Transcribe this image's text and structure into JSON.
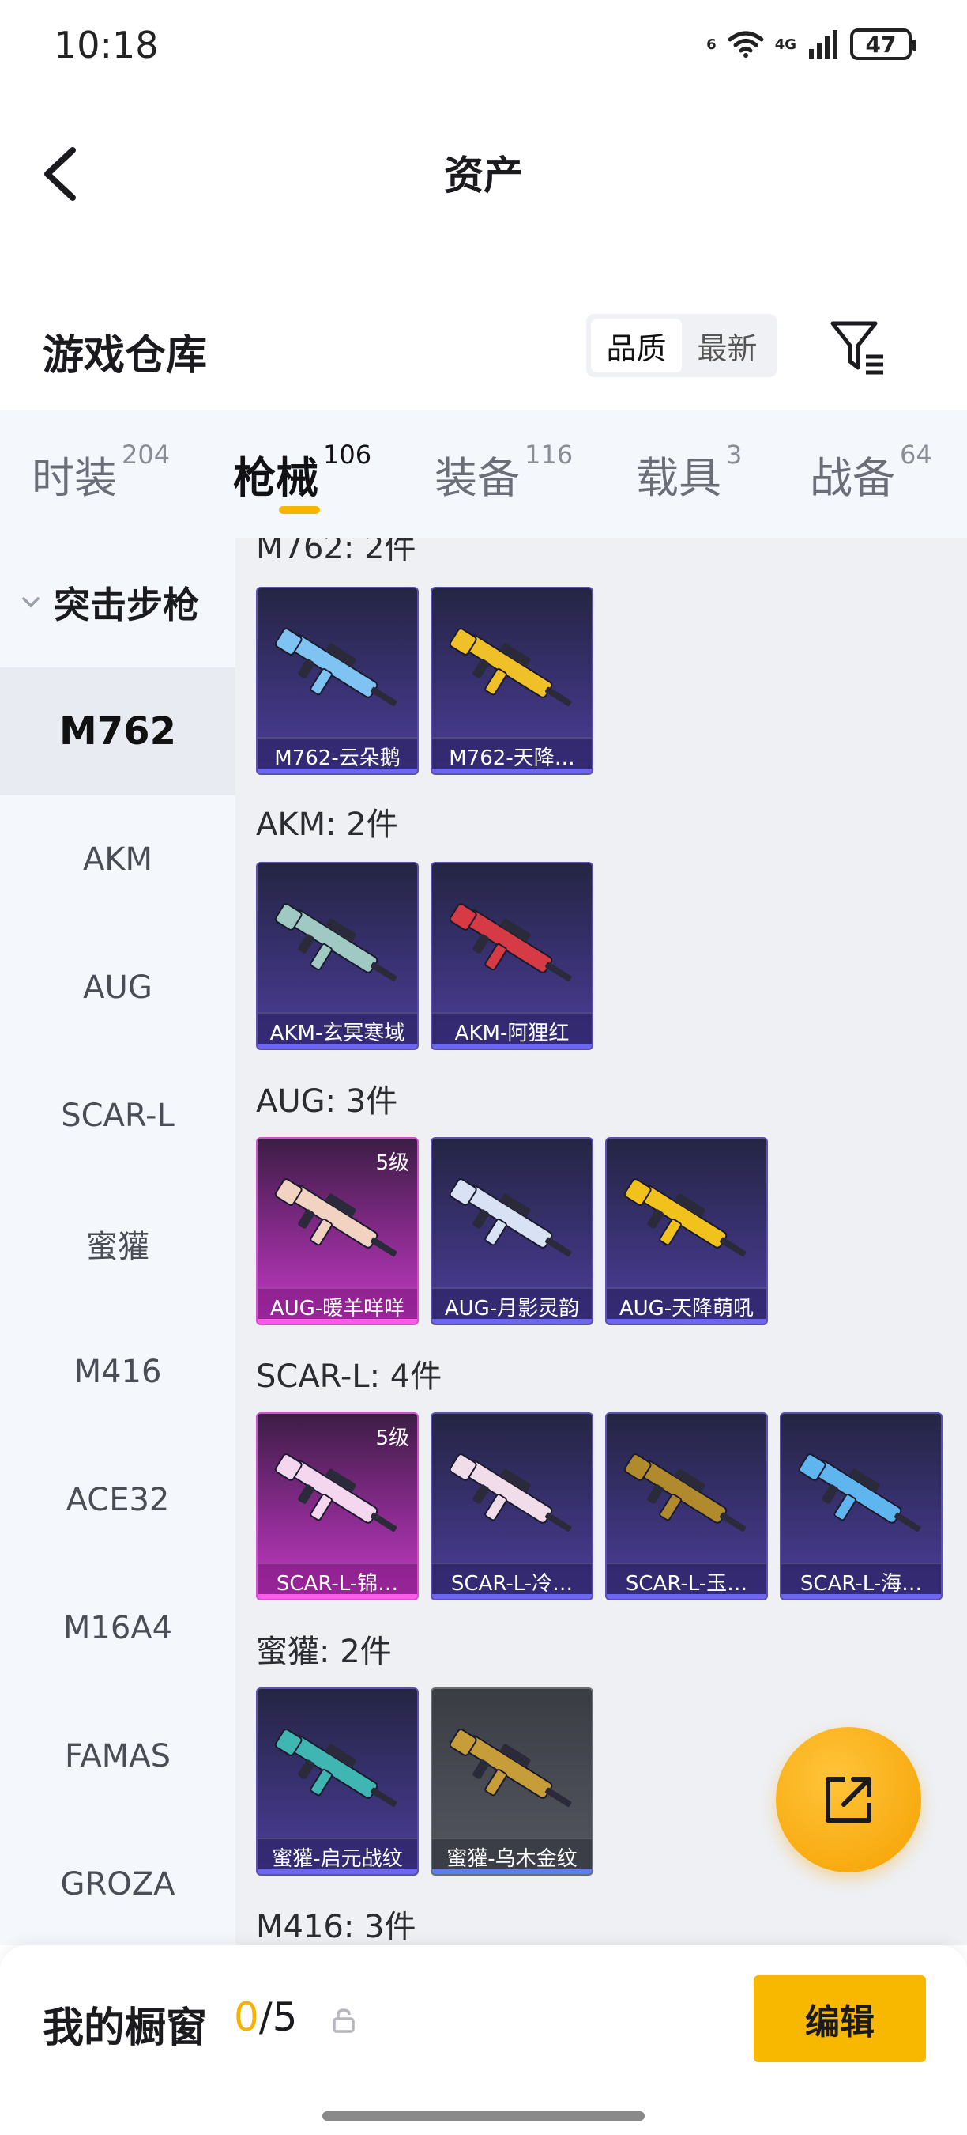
{
  "status_bar": {
    "time": "10:18",
    "battery": "47",
    "wifi_tag": "6",
    "net_tag": "4G"
  },
  "header": {
    "title": "资产"
  },
  "warehouse": {
    "title": "游戏仓库",
    "sort_options": [
      "品质",
      "最新"
    ],
    "active_sort": "品质"
  },
  "tabs": [
    {
      "label": "时装",
      "count": "204"
    },
    {
      "label": "枪械",
      "count": "106",
      "active": true
    },
    {
      "label": "装备",
      "count": "116"
    },
    {
      "label": "载具",
      "count": "3"
    },
    {
      "label": "战备",
      "count": "64"
    }
  ],
  "sidebar": {
    "group": "突击步枪",
    "items": [
      "M762",
      "AKM",
      "AUG",
      "SCAR-L",
      "蜜獾",
      "M416",
      "ACE32",
      "M16A4",
      "FAMAS",
      "GROZA"
    ],
    "active": "M762"
  },
  "sections": [
    {
      "title": "M762: 2件",
      "items": [
        {
          "name": "M762-云朵鹅",
          "rarity": "purple",
          "gun_color": "#7ec3f2"
        },
        {
          "name": "M762-天降…",
          "rarity": "purple",
          "gun_color": "#f0c028"
        }
      ]
    },
    {
      "title": "AKM: 2件",
      "items": [
        {
          "name": "AKM-玄冥寒域",
          "rarity": "purple",
          "gun_color": "#9fc9c2"
        },
        {
          "name": "AKM-阿狸红",
          "rarity": "purple",
          "gun_color": "#d63a44"
        }
      ]
    },
    {
      "title": "AUG: 3件",
      "items": [
        {
          "name": "AUG-暖羊咩咩",
          "rarity": "pink",
          "badge": "5级",
          "gun_color": "#f2d2c0"
        },
        {
          "name": "AUG-月影灵韵",
          "rarity": "purple",
          "gun_color": "#d9e1f5"
        },
        {
          "name": "AUG-天降萌吼",
          "rarity": "purple",
          "gun_color": "#f2c21c"
        }
      ]
    },
    {
      "title": "SCAR-L: 4件",
      "items": [
        {
          "name": "SCAR-L-锦…",
          "rarity": "pink",
          "badge": "5级",
          "gun_color": "#f4d7ee"
        },
        {
          "name": "SCAR-L-冷…",
          "rarity": "purple",
          "gun_color": "#f1dde9"
        },
        {
          "name": "SCAR-L-玉…",
          "rarity": "purple",
          "gun_color": "#b08a2c"
        },
        {
          "name": "SCAR-L-海…",
          "rarity": "purple",
          "gun_color": "#5fb6ef"
        }
      ]
    },
    {
      "title": "蜜獾: 2件",
      "items": [
        {
          "name": "蜜獾-启元战纹",
          "rarity": "purple",
          "gun_color": "#3fb6b2"
        },
        {
          "name": "蜜獾-乌木金纹",
          "rarity": "gray",
          "gun_color": "#c79d3a"
        }
      ]
    },
    {
      "title": "M416: 3件",
      "items": []
    }
  ],
  "showcase": {
    "title": "我的橱窗",
    "current": "0",
    "total": "/5",
    "edit_label": "编辑"
  }
}
